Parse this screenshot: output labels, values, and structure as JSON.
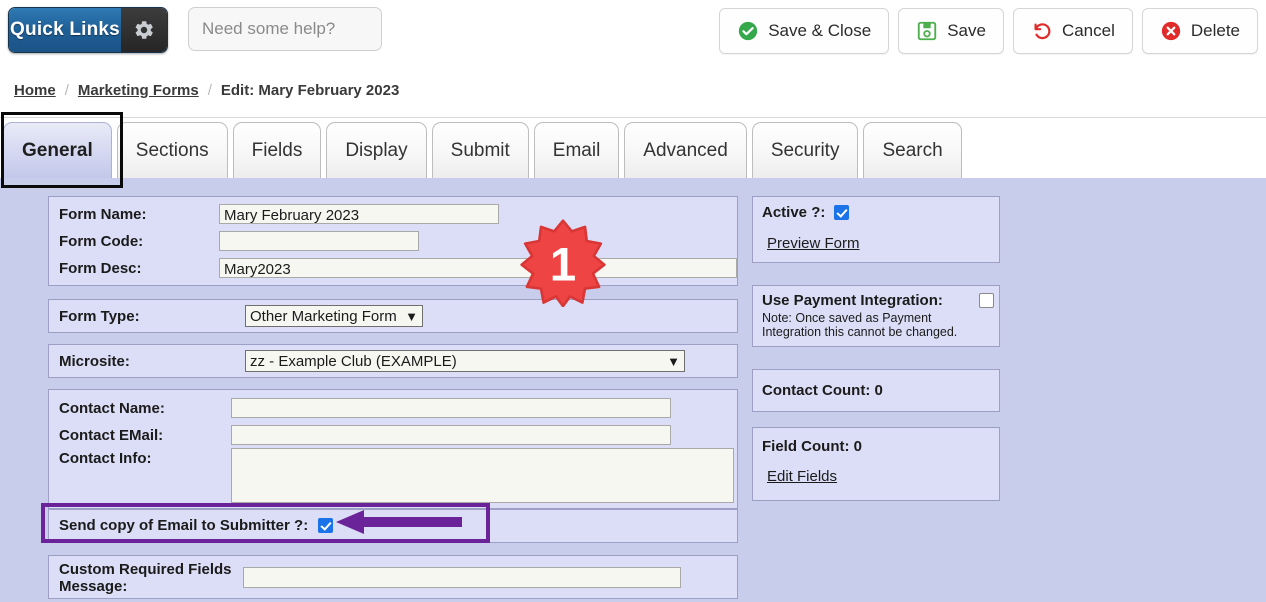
{
  "topbar": {
    "quick_links_label": "Quick Links",
    "gear_icon": "gear-icon",
    "help_placeholder": "Need some help?",
    "buttons": [
      {
        "label": "Save & Close",
        "icon": "check-circle-icon",
        "color": "#35a84c"
      },
      {
        "label": "Save",
        "icon": "floppy-disk-icon",
        "color": "#4cae4c"
      },
      {
        "label": "Cancel",
        "icon": "undo-arrow-icon",
        "color": "#e02b2b"
      },
      {
        "label": "Delete",
        "icon": "x-circle-icon",
        "color": "#e02b2b"
      }
    ]
  },
  "breadcrumb": {
    "home": "Home",
    "section": "Marketing Forms",
    "current": "Edit: Mary February 2023",
    "separator": "/"
  },
  "tabs": [
    {
      "label": "General",
      "active": true
    },
    {
      "label": "Sections",
      "active": false
    },
    {
      "label": "Fields",
      "active": false
    },
    {
      "label": "Display",
      "active": false
    },
    {
      "label": "Submit",
      "active": false
    },
    {
      "label": "Email",
      "active": false
    },
    {
      "label": "Advanced",
      "active": false
    },
    {
      "label": "Security",
      "active": false
    },
    {
      "label": "Search",
      "active": false
    }
  ],
  "form": {
    "form_name_label": "Form Name:",
    "form_name_value": "Mary February 2023",
    "form_code_label": "Form Code:",
    "form_code_value": "",
    "form_desc_label": "Form Desc:",
    "form_desc_value": "Mary2023",
    "form_type_label": "Form Type:",
    "form_type_value": "Other Marketing Form",
    "microsite_label": "Microsite:",
    "microsite_value": "zz - Example Club (EXAMPLE)",
    "contact_name_label": "Contact Name:",
    "contact_name_value": "",
    "contact_email_label": "Contact EMail:",
    "contact_email_value": "",
    "contact_info_label": "Contact Info:",
    "contact_info_value": "",
    "send_copy_label": "Send copy of Email to Submitter ?:",
    "send_copy_checked": true,
    "custom_required_label": "Custom Required Fields Message:",
    "custom_required_value": ""
  },
  "sidebar": {
    "active_label": "Active ?:",
    "active_checked": true,
    "preview_form_link": "Preview Form",
    "payment_label": "Use Payment Integration:",
    "payment_checked": false,
    "payment_note": "Note: Once saved as Payment Integration this cannot be changed.",
    "contact_count": "Contact Count: 0",
    "field_count": "Field Count: 0",
    "edit_fields_link": "Edit Fields"
  },
  "annotations": {
    "step_badge": "1",
    "badge_color": "#ef4444",
    "highlight_color": "#6a2399",
    "tab_outline_color": "#0a0a0a"
  }
}
